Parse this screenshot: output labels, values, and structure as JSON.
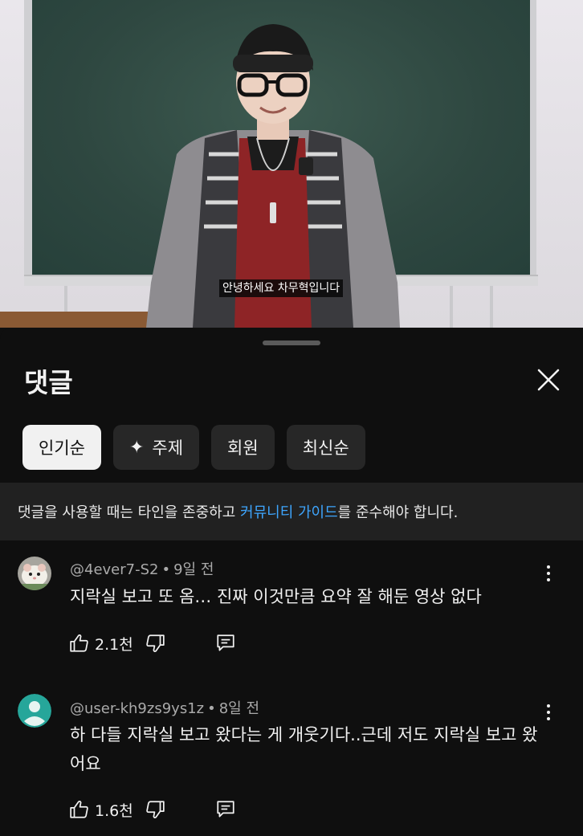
{
  "video": {
    "subtitle": "안녕하세요 차무혁입니다"
  },
  "sheet": {
    "title": "댓글"
  },
  "chips": [
    {
      "label": "인기순",
      "active": true
    },
    {
      "label": "주제",
      "icon": "sparkle-icon"
    },
    {
      "label": "회원"
    },
    {
      "label": "최신순"
    }
  ],
  "guideline": {
    "before": "댓글을 사용할 때는 타인을 존중하고 ",
    "link": "커뮤니티 가이드",
    "after": "를 준수해야 합니다."
  },
  "comments": [
    {
      "author": "@4ever7-S2",
      "time": "9일 전",
      "text": "지락실 보고 또 옴… 진짜 이것만큼 요약 잘 해둔 영상 없다",
      "likes": "2.1천"
    },
    {
      "author": "@user-kh9zs9ys1z",
      "time": "8일 전",
      "text": "하 다들 지락실 보고 왔다는 게 개웃기다..근데 저도 지락실 보고 왔어요",
      "likes": "1.6천"
    }
  ],
  "meta_separator": "•",
  "colors": {
    "background": "#0f0f0f",
    "chip": "#272727",
    "chip_active": "#f1f1f1",
    "link": "#3ea6ff",
    "avatar_default": "#26a69a"
  }
}
